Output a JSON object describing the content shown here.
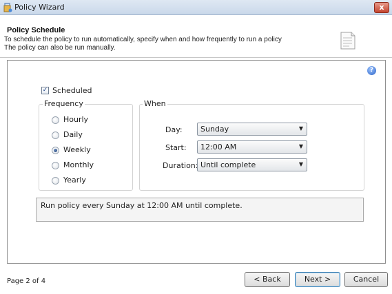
{
  "window": {
    "title": "Policy Wizard",
    "close_label": "x"
  },
  "header": {
    "title": "Policy Schedule",
    "description_line1": "To schedule the policy to run automatically, specify when and how frequently to run a policy",
    "description_line2": "The policy can also be run manually."
  },
  "help_glyph": "?",
  "scheduled": {
    "label": "Scheduled",
    "checked": true,
    "check_glyph": "✓"
  },
  "frequency": {
    "legend": "Frequency",
    "options": [
      {
        "label": "Hourly",
        "selected": false
      },
      {
        "label": "Daily",
        "selected": false
      },
      {
        "label": "Weekly",
        "selected": true
      },
      {
        "label": "Monthly",
        "selected": false
      },
      {
        "label": "Yearly",
        "selected": false
      }
    ]
  },
  "when": {
    "legend": "When",
    "day": {
      "label": "Day:",
      "value": "Sunday"
    },
    "start": {
      "label": "Start:",
      "value": "12:00 AM"
    },
    "duration": {
      "label": "Duration:",
      "value": "Until complete"
    },
    "arrow_glyph": "▼"
  },
  "summary_text": "Run policy every Sunday at 12:00 AM until complete.",
  "footer": {
    "page_label": "Page 2 of 4",
    "back_label": "< Back",
    "next_label": "Next >",
    "cancel_label": "Cancel"
  },
  "colors": {
    "titlebar": "#c9d8ea",
    "close_button": "#c4452f",
    "radio_selected": "#1f3f75",
    "summary_background": "#f4f4f4"
  }
}
